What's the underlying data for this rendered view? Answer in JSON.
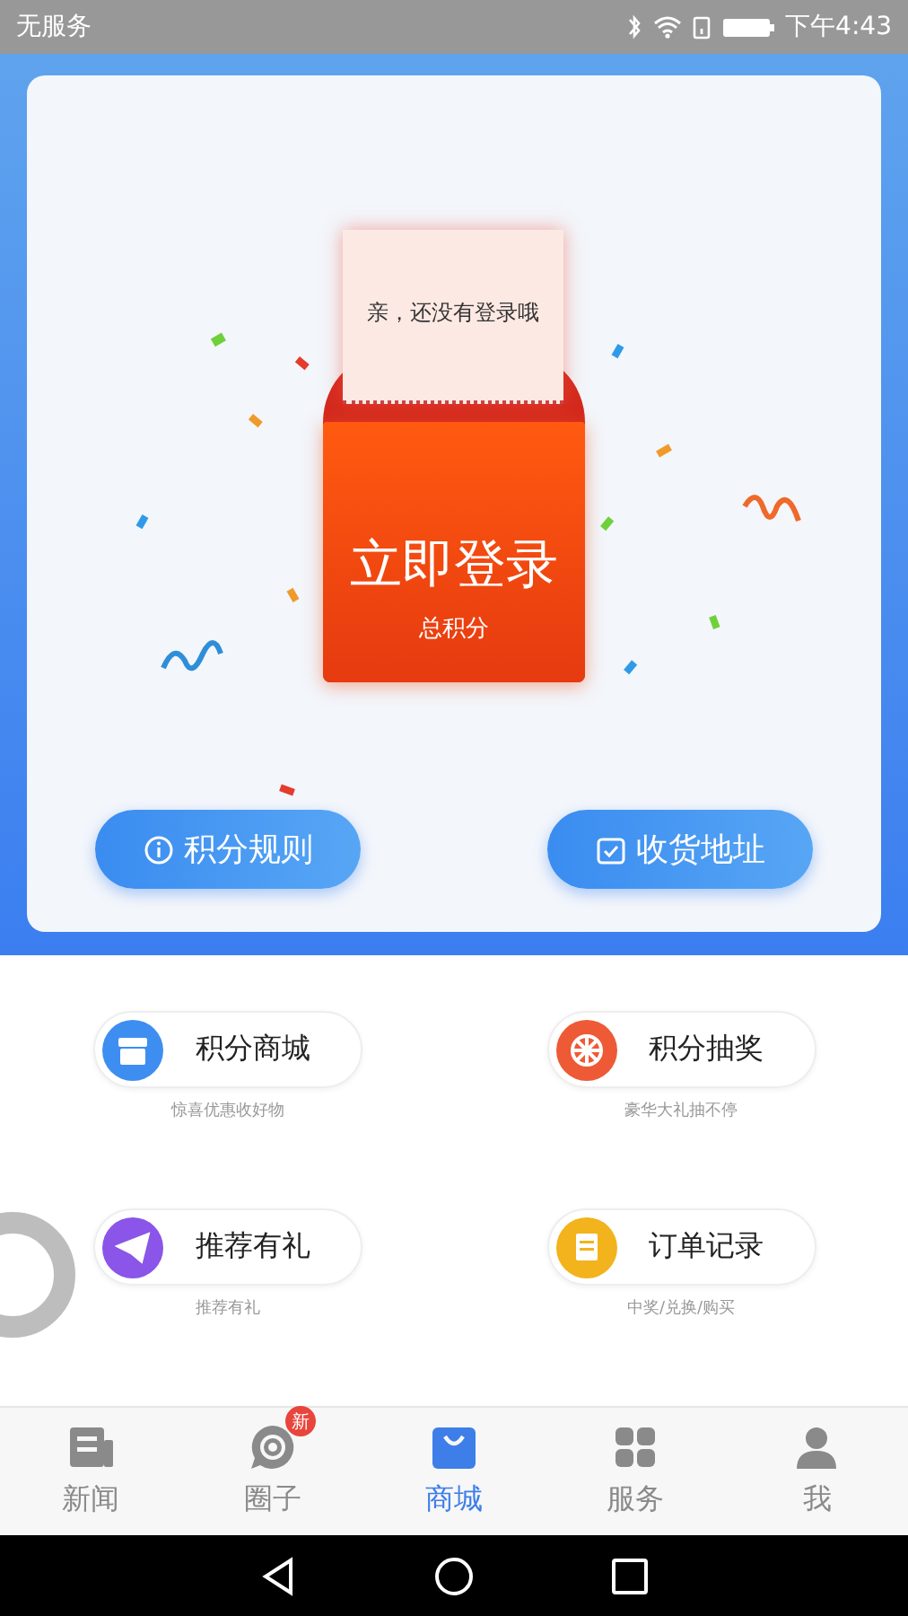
{
  "status_bar": {
    "carrier": "无服务",
    "time": "下午4:43"
  },
  "card": {
    "ticket_text": "亲，还没有登录哦",
    "login_title": "立即登录",
    "points_label": "总积分",
    "buttons": [
      {
        "label": "积分规则"
      },
      {
        "label": "收货地址"
      }
    ]
  },
  "features": [
    {
      "title": "积分商城",
      "subtitle": "惊喜优惠收好物",
      "color": "#3d8ef0"
    },
    {
      "title": "积分抽奖",
      "subtitle": "豪华大礼抽不停",
      "color": "#ee5a35"
    },
    {
      "title": "推荐有礼",
      "subtitle": "推荐有礼",
      "color": "#8a55e8"
    },
    {
      "title": "订单记录",
      "subtitle": "中奖/兑换/购买",
      "color": "#f2b31c"
    }
  ],
  "tabs": [
    {
      "label": "新闻",
      "selected": false
    },
    {
      "label": "圈子",
      "selected": false,
      "badge": "新"
    },
    {
      "label": "商城",
      "selected": true
    },
    {
      "label": "服务",
      "selected": false
    },
    {
      "label": "我",
      "selected": false
    }
  ]
}
